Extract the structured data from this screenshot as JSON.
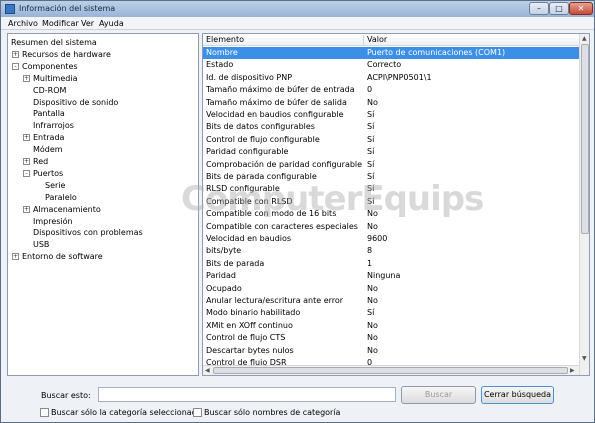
{
  "window": {
    "title": "Información del sistema",
    "min": "–",
    "max": "□",
    "close": "✕"
  },
  "menu": [
    "Archivo",
    "Modificar",
    "Ver",
    "Ayuda"
  ],
  "tree": [
    {
      "label": "Resumen del sistema",
      "level": 0,
      "toggle": ""
    },
    {
      "label": "Recursos de hardware",
      "level": 1,
      "toggle": "+"
    },
    {
      "label": "Componentes",
      "level": 1,
      "toggle": "-"
    },
    {
      "label": "Multimedia",
      "level": 2,
      "toggle": "+"
    },
    {
      "label": "CD-ROM",
      "level": 2,
      "toggle": ""
    },
    {
      "label": "Dispositivo de sonido",
      "level": 2,
      "toggle": ""
    },
    {
      "label": "Pantalla",
      "level": 2,
      "toggle": ""
    },
    {
      "label": "Infrarrojos",
      "level": 2,
      "toggle": ""
    },
    {
      "label": "Entrada",
      "level": 2,
      "toggle": "+"
    },
    {
      "label": "Módem",
      "level": 2,
      "toggle": ""
    },
    {
      "label": "Red",
      "level": 2,
      "toggle": "+"
    },
    {
      "label": "Puertos",
      "level": 2,
      "toggle": "-"
    },
    {
      "label": "Serie",
      "level": 3,
      "toggle": ""
    },
    {
      "label": "Paralelo",
      "level": 3,
      "toggle": ""
    },
    {
      "label": "Almacenamiento",
      "level": 2,
      "toggle": "+"
    },
    {
      "label": "Impresión",
      "level": 2,
      "toggle": ""
    },
    {
      "label": "Dispositivos con problemas",
      "level": 2,
      "toggle": ""
    },
    {
      "label": "USB",
      "level": 2,
      "toggle": ""
    },
    {
      "label": "Entorno de software",
      "level": 1,
      "toggle": "+"
    }
  ],
  "list": {
    "headers": [
      "Elemento",
      "Valor"
    ],
    "rows": [
      [
        "Nombre",
        "Puerto de comunicaciones (COM1)"
      ],
      [
        "Estado",
        "Correcto"
      ],
      [
        "Id. de dispositivo PNP",
        "ACPI\\PNP0501\\1"
      ],
      [
        "Tamaño máximo de búfer de entrada",
        "0"
      ],
      [
        "Tamaño máximo de búfer de salida",
        "No"
      ],
      [
        "Velocidad en baudios configurable",
        "Sí"
      ],
      [
        "Bits de datos configurables",
        "Sí"
      ],
      [
        "Control de flujo configurable",
        "Sí"
      ],
      [
        "Paridad configurable",
        "Sí"
      ],
      [
        "Comprobación de paridad configurable",
        "Sí"
      ],
      [
        "Bits de parada configurable",
        "Sí"
      ],
      [
        "RLSD configurable",
        "Sí"
      ],
      [
        "Compatible con RLSD",
        "Sí"
      ],
      [
        "Compatible con modo de 16 bits",
        "No"
      ],
      [
        "Compatible con caracteres especiales",
        "No"
      ],
      [
        "Velocidad en baudios",
        "9600"
      ],
      [
        "bits/byte",
        "8"
      ],
      [
        "Bits de parada",
        "1"
      ],
      [
        "Paridad",
        "Ninguna"
      ],
      [
        "Ocupado",
        "No"
      ],
      [
        "Anular lectura/escritura ante error",
        "No"
      ],
      [
        "Modo binario habilitado",
        "Sí"
      ],
      [
        "XMit en XOff continuo",
        "No"
      ],
      [
        "Control de flujo CTS",
        "No"
      ],
      [
        "Descartar bytes nulos",
        "No"
      ],
      [
        "Control de flujo DSR",
        "0"
      ]
    ]
  },
  "search": {
    "label": "Buscar esto:",
    "value": "",
    "find_button": "Buscar",
    "close_button": "Cerrar búsqueda"
  },
  "options": {
    "selected_category": "Buscar sólo la categoría seleccionada",
    "category_names": "Buscar sólo nombres de categoría"
  },
  "watermark": "ComputerEquips"
}
